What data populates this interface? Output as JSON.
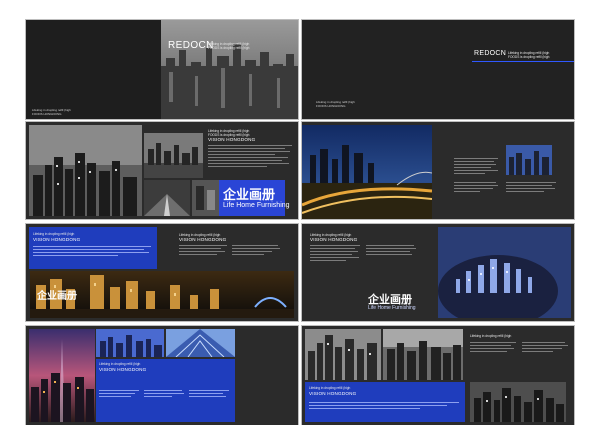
{
  "brand": {
    "logo": "REDOCN"
  },
  "tagline": {
    "line1": "Lifeking in dropling refill (high",
    "line2": "FOODS is dropling refill (high"
  },
  "small_info": {
    "line1": "Lifeking in dropling refill (high",
    "line2": "FOODS HONGDONG"
  },
  "section": {
    "heading": "VISION HONGDONG"
  },
  "promo": {
    "cn_title": "企业画册",
    "en_title": "Life Home Furnishing"
  },
  "colors": {
    "accent_blue": "#1f3dbd",
    "bright_blue": "#2f58ff",
    "spread_bg": "#2b2b2b"
  }
}
